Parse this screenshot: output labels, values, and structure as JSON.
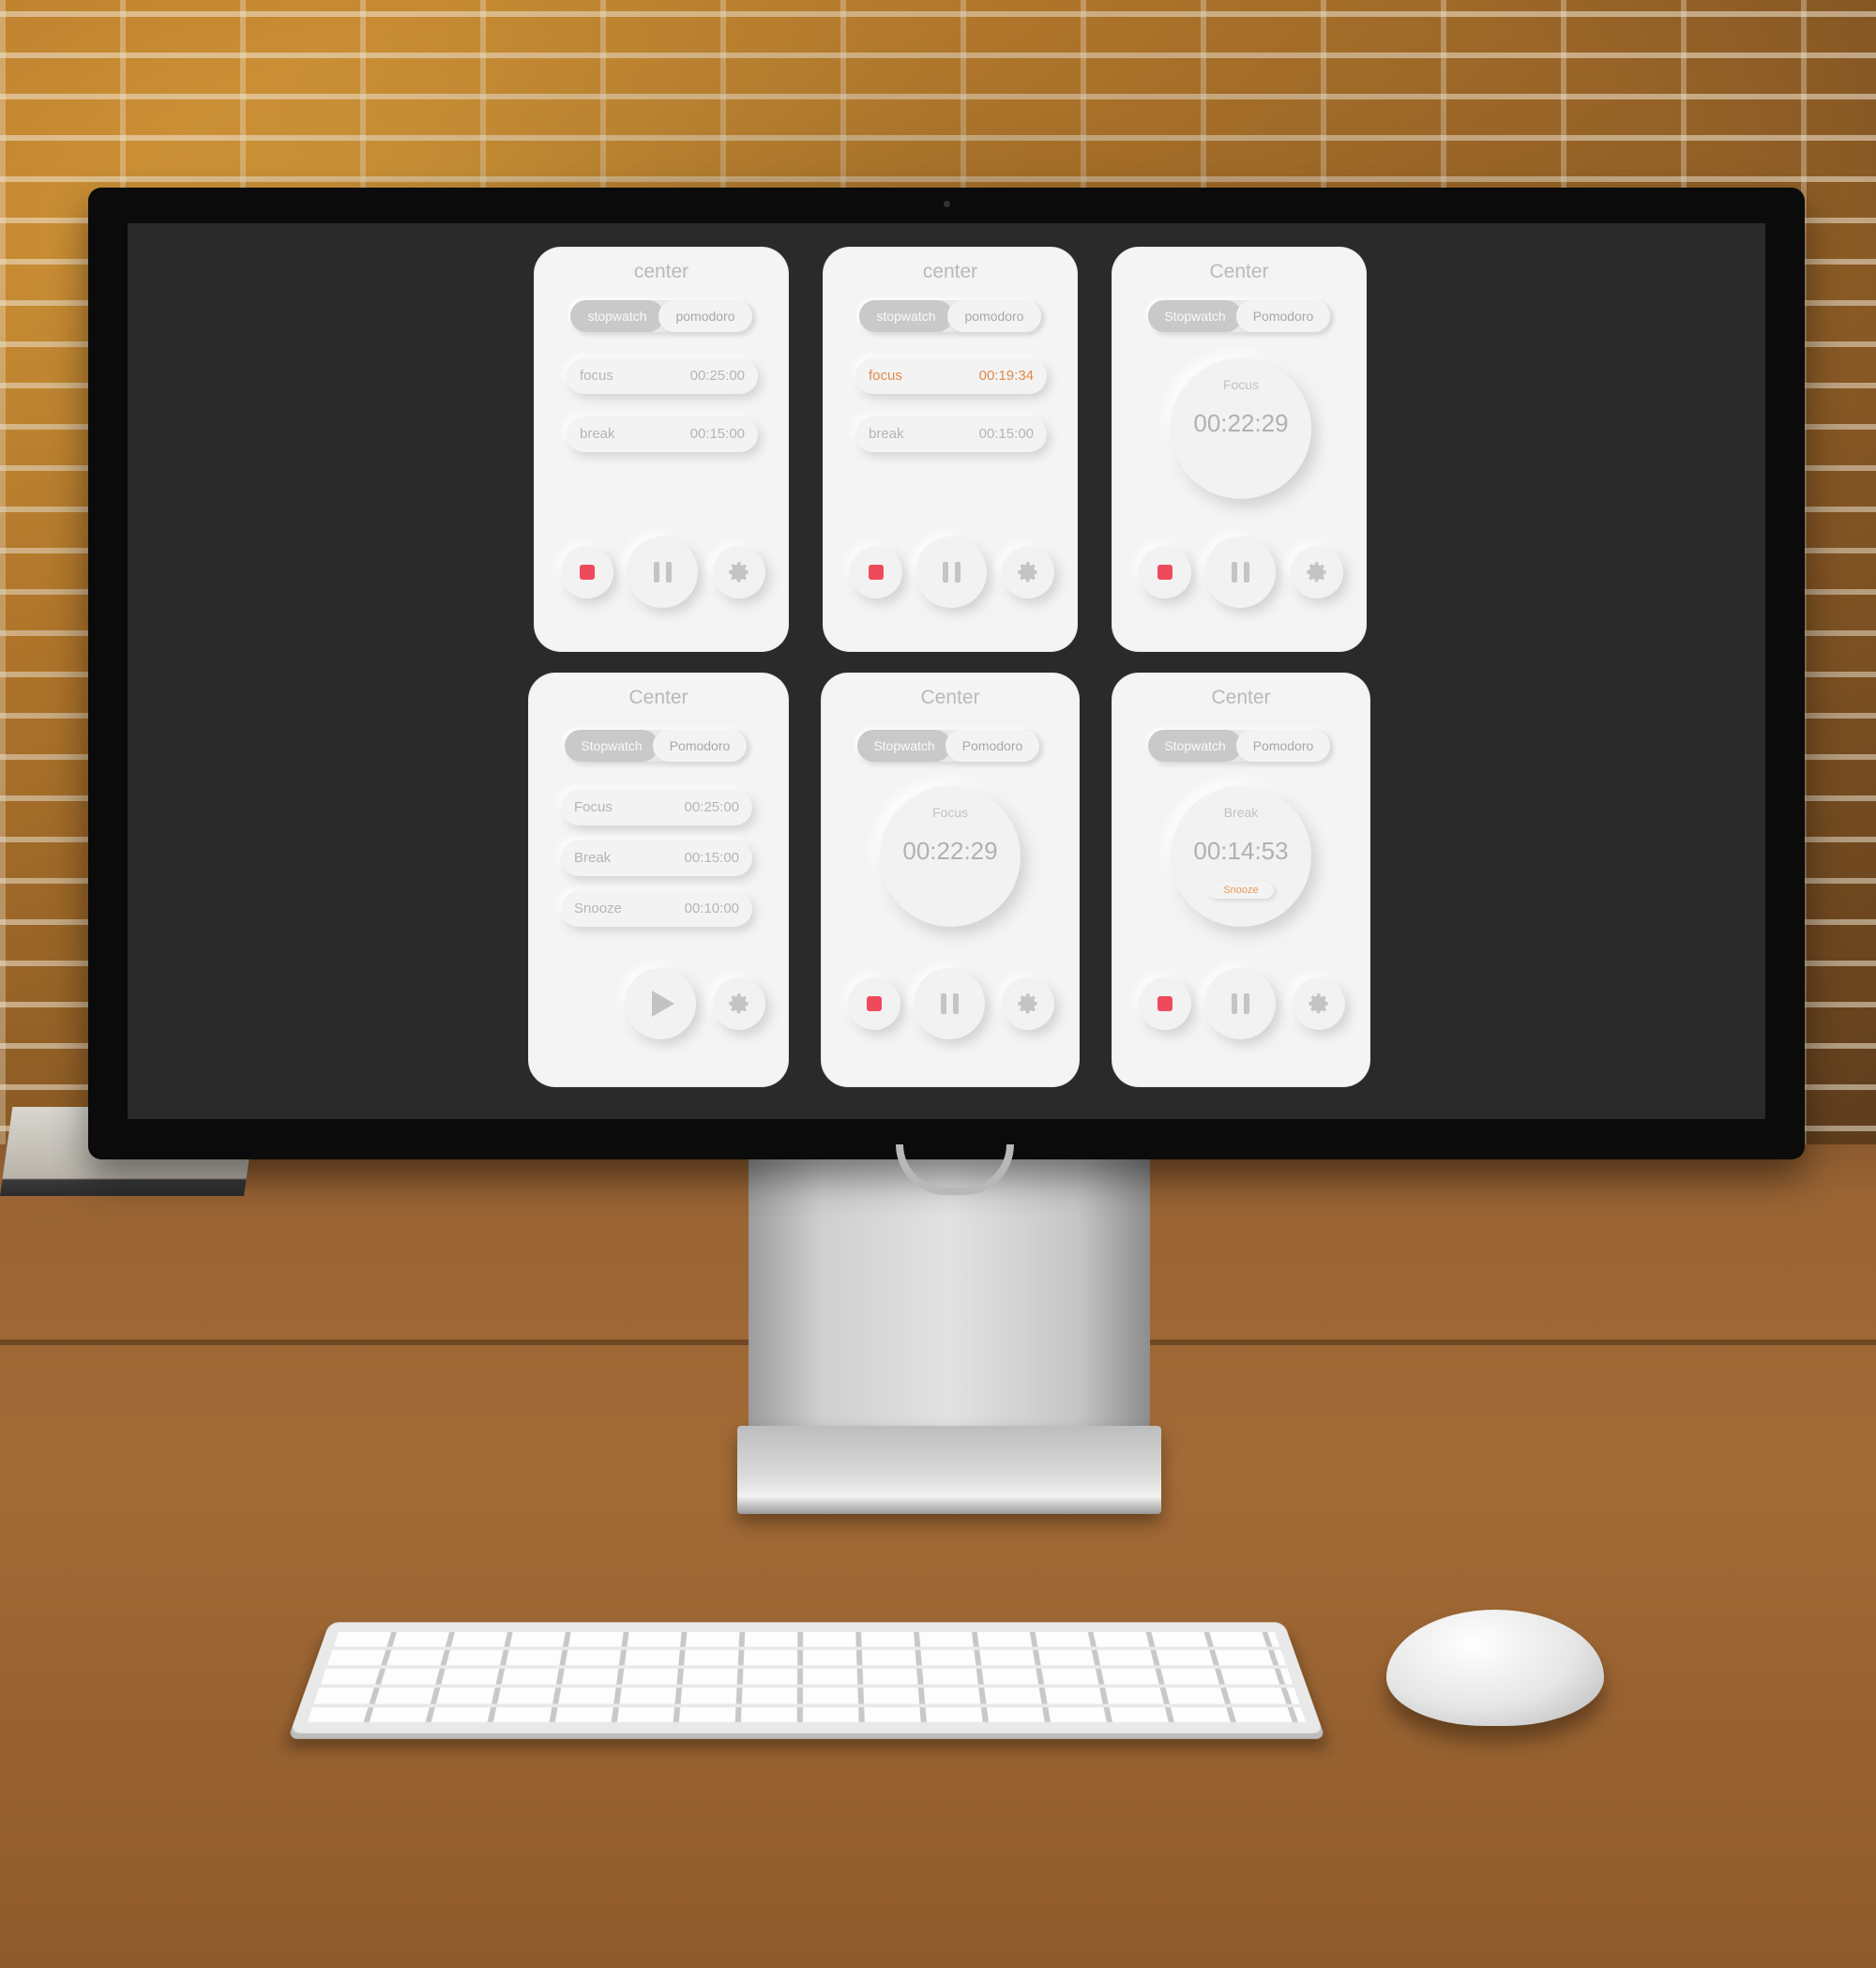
{
  "scene": {
    "description_free": true
  },
  "cards": [
    {
      "title": "center",
      "tabs": {
        "active": "stopwatch",
        "inactive": "pomodoro"
      },
      "rows": [
        {
          "label": "focus",
          "time": "00:25:00",
          "highlight": false
        },
        {
          "label": "break",
          "time": "00:15:00",
          "highlight": false
        }
      ],
      "controls": [
        "stop",
        "pause",
        "settings"
      ]
    },
    {
      "title": "center",
      "tabs": {
        "active": "stopwatch",
        "inactive": "pomodoro"
      },
      "rows": [
        {
          "label": "focus",
          "time": "00:19:34",
          "highlight": true
        },
        {
          "label": "break",
          "time": "00:15:00",
          "highlight": false
        }
      ],
      "controls": [
        "stop",
        "pause",
        "settings"
      ]
    },
    {
      "title": "Center",
      "tabs": {
        "active": "Stopwatch",
        "inactive": "Pomodoro"
      },
      "dial": {
        "label": "Focus",
        "time": "00:22:29"
      },
      "controls": [
        "stop",
        "pause",
        "settings"
      ]
    },
    {
      "title": "Center",
      "tabs": {
        "active": "Stopwatch",
        "inactive": "Pomodoro"
      },
      "rows": [
        {
          "label": "Focus",
          "time": "00:25:00",
          "highlight": false
        },
        {
          "label": "Break",
          "time": "00:15:00",
          "highlight": false
        },
        {
          "label": "Snooze",
          "time": "00:10:00",
          "highlight": false
        }
      ],
      "controls": [
        "play",
        "settings"
      ]
    },
    {
      "title": "Center",
      "tabs": {
        "active": "Stopwatch",
        "inactive": "Pomodoro"
      },
      "dial": {
        "label": "Focus",
        "time": "00:22:29"
      },
      "controls": [
        "stop",
        "pause",
        "settings"
      ]
    },
    {
      "title": "Center",
      "tabs": {
        "active": "Stopwatch",
        "inactive": "Pomodoro"
      },
      "dial": {
        "label": "Break",
        "time": "00:14:53",
        "badge": "Snooze"
      },
      "controls": [
        "stop",
        "pause",
        "settings"
      ]
    }
  ],
  "colors": {
    "stop": "#ef4a5c",
    "highlight": "#e08a4a",
    "card": "#f4f4f4",
    "screen": "#2a2a2a"
  },
  "icons": {
    "stop": "stop-icon",
    "pause": "pause-icon",
    "play": "play-icon",
    "settings": "gear-icon"
  }
}
